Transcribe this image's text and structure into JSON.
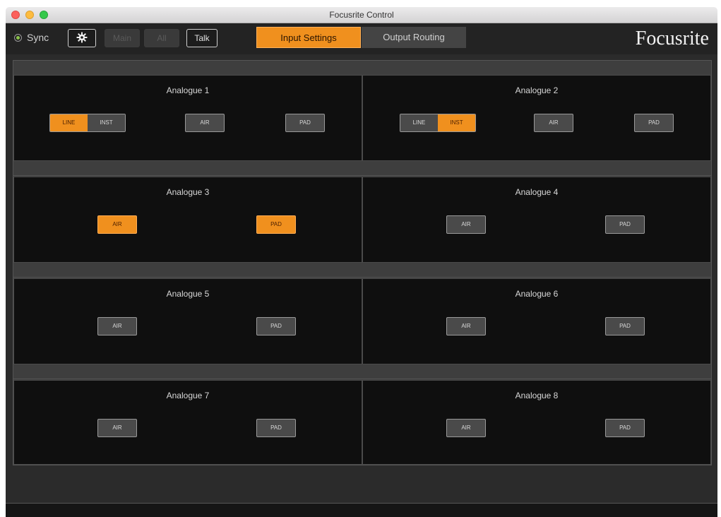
{
  "window": {
    "title": "Focusrite Control"
  },
  "toolbar": {
    "sync_label": "Sync",
    "buttons": {
      "main": "Main",
      "all": "All",
      "talk": "Talk"
    },
    "tabs": [
      "Input Settings",
      "Output Routing"
    ],
    "brand": "Focusrite"
  },
  "colors": {
    "accent": "#f0901e",
    "panel_bg": "#0f0f0f",
    "button_off": "#4a4a4a",
    "sync_led": "#8bc34a"
  },
  "icons": {
    "settings": "gear-icon",
    "sync": "radio-indicator-icon"
  },
  "labels": {
    "line": "LINE",
    "inst": "INST",
    "air": "AIR",
    "pad": "PAD"
  },
  "channels": [
    {
      "name": "Analogue 1",
      "line_inst": "LINE",
      "air": false,
      "pad": false
    },
    {
      "name": "Analogue 2",
      "line_inst": "INST",
      "air": false,
      "pad": false
    },
    {
      "name": "Analogue 3",
      "air": true,
      "pad": true
    },
    {
      "name": "Analogue 4",
      "air": false,
      "pad": false
    },
    {
      "name": "Analogue 5",
      "air": false,
      "pad": false
    },
    {
      "name": "Analogue 6",
      "air": false,
      "pad": false
    },
    {
      "name": "Analogue 7",
      "air": false,
      "pad": false
    },
    {
      "name": "Analogue 8",
      "air": false,
      "pad": false
    }
  ]
}
